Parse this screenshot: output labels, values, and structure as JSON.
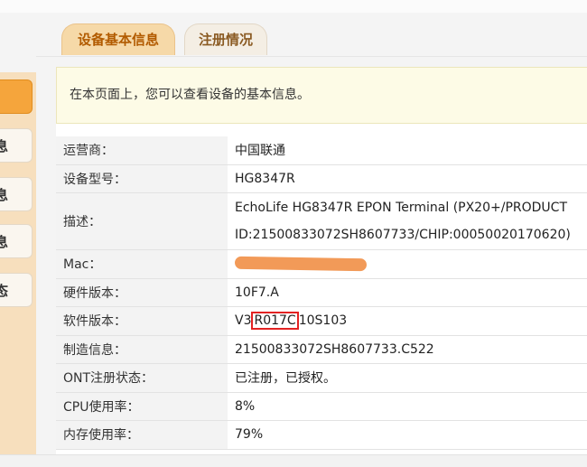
{
  "tabs": [
    {
      "label": "设备基本信息",
      "active": true
    },
    {
      "label": "注册情况",
      "active": false
    }
  ],
  "sidebar": {
    "items": [
      {
        "label": "",
        "active": true
      },
      {
        "label": "息"
      },
      {
        "label": "息"
      },
      {
        "label": "息"
      },
      {
        "label": "态"
      }
    ]
  },
  "notice": "在本页面上，您可以查看设备的基本信息。",
  "device_info": {
    "rows": [
      {
        "label": "运营商：",
        "value": "中国联通"
      },
      {
        "label": "设备型号：",
        "value": "HG8347R"
      },
      {
        "label": "描述：",
        "value_line1": "EchoLife HG8347R EPON Terminal (PX20+/PRODUCT",
        "value_line2": "ID:21500833072SH8607733/CHIP:00050020170620)"
      },
      {
        "label": "Mac：",
        "value": ""
      },
      {
        "label": "硬件版本：",
        "value": "10F7.A"
      },
      {
        "label": "软件版本：",
        "value_prefix": "V3",
        "value_highlight": "R017C",
        "value_suffix": "10S103"
      },
      {
        "label": "制造信息：",
        "value": "21500833072SH8607733.C522"
      },
      {
        "label": "ONT注册状态：",
        "value": "已注册，已授权。"
      },
      {
        "label": "CPU使用率：",
        "value": "8%"
      },
      {
        "label": "内存使用率：",
        "value": "79%"
      }
    ]
  },
  "colors": {
    "tab_active_bg": "#f6d9a8",
    "accent_orange": "#f5a53c",
    "redaction": "#f29a58",
    "highlight_box": "#e32222"
  }
}
